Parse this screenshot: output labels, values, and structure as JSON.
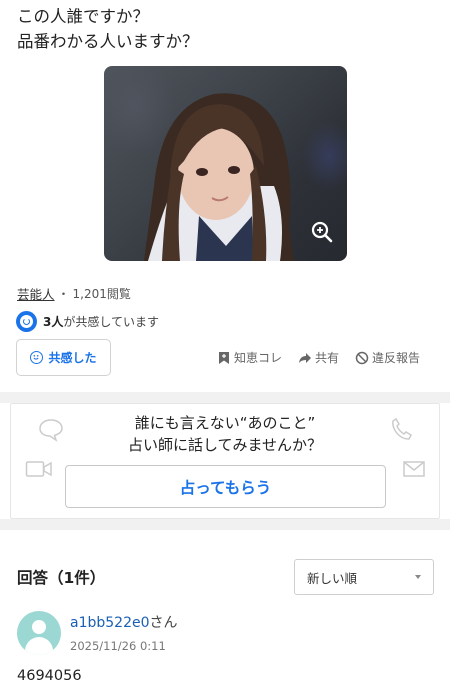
{
  "question": {
    "line1": "この人誰ですか？",
    "line2": "品番わかる人いますか？"
  },
  "photo": {
    "zoom_icon": "zoom-in-icon"
  },
  "meta": {
    "category": "芸能人",
    "separator": "・",
    "views": "1,201閲覧"
  },
  "empathy": {
    "count": "3人",
    "text": "が共感しています",
    "button_label": "共感した"
  },
  "actions": {
    "chiebukuro": "知恵コレ",
    "share": "共有",
    "report": "違反報告"
  },
  "fortune": {
    "line1": "誰にも言えない“あのこと”",
    "line2": "占い師に話してみませんか？",
    "button_label": "占ってもらう"
  },
  "answers": {
    "heading": "回答（1件）",
    "sort_selected": "新しい順"
  },
  "answer_item": {
    "username": "a1bb522e0",
    "suffix": "さん",
    "date": "2025/11/26 0:11",
    "text": "4694056"
  },
  "colors": {
    "accent": "#1a73e8",
    "link": "#1a5fb4",
    "avatar_bg": "#9cd8d3"
  }
}
